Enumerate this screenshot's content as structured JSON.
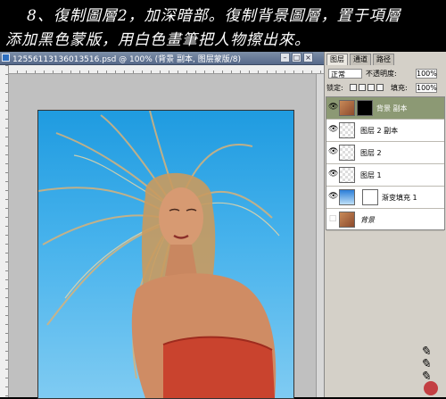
{
  "caption": {
    "line1": "8、復制圖層2，加深暗部。復制背景圖層，置于項層",
    "line2": "添加黑色蒙版，用白色畫筆把人物擦出來。"
  },
  "document": {
    "title": "12556113136013516.psd @ 100% (背景 副本, 图层蒙版/8)"
  },
  "panel": {
    "tabs": [
      "图层",
      "通道",
      "路径"
    ],
    "blend_mode": "正常",
    "opacity_label": "不透明度:",
    "opacity_value": "100%",
    "lock_label": "锁定:",
    "fill_label": "填充:",
    "fill_value": "100%",
    "layers": [
      {
        "name": "背景 副本",
        "selected": true
      },
      {
        "name": "图层 2 副本",
        "selected": false
      },
      {
        "name": "图层 2",
        "selected": false
      },
      {
        "name": "图层 1",
        "selected": false
      },
      {
        "name": "渐变填充 1",
        "selected": false
      },
      {
        "name": "背景",
        "selected": false
      }
    ]
  },
  "colors": {
    "selected_layer": "#8c9974",
    "sky": "#1f9be0",
    "titlebar": "#56698a"
  }
}
